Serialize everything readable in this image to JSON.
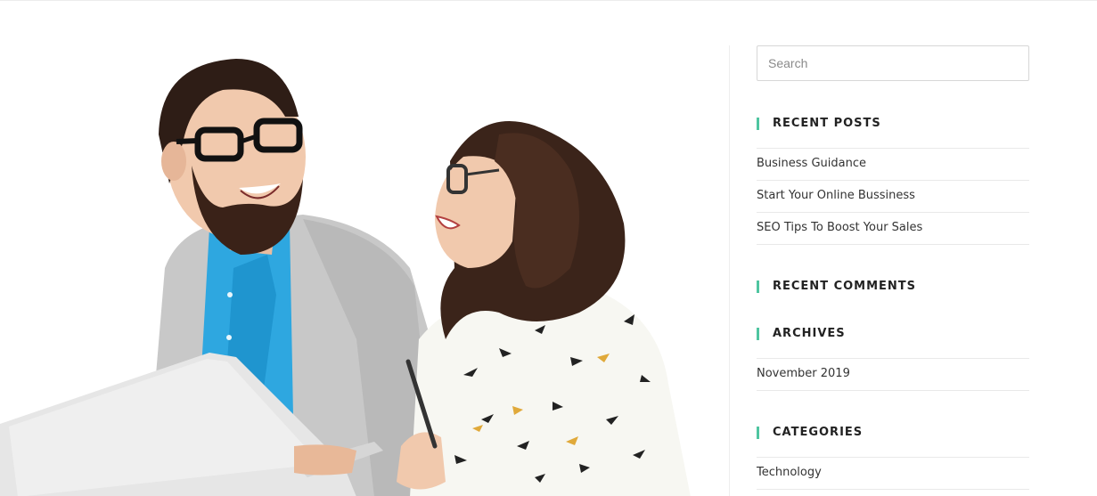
{
  "featured_image": {
    "description_icon": "photo-people-laptop",
    "colors": {
      "background": "#ffffff",
      "skin": "#f1c9ad",
      "hair": "#3a2218",
      "shirt": "#2ea7e0",
      "blazer": "#c9c9c9",
      "laptop": "#e2e2e2",
      "blouse": "#f7f7f2"
    }
  },
  "search": {
    "placeholder": "Search",
    "value": ""
  },
  "widgets": {
    "recent_posts": {
      "title": "RECENT POSTS",
      "items": [
        "Business Guidance",
        "Start Your Online Bussiness",
        "SEO Tips To Boost Your Sales"
      ]
    },
    "recent_comments": {
      "title": "RECENT COMMENTS"
    },
    "archives": {
      "title": "ARCHIVES",
      "items": [
        "November 2019"
      ]
    },
    "categories": {
      "title": "CATEGORIES",
      "items": [
        "Technology"
      ]
    }
  },
  "colors": {
    "accent": "#4fc5a0",
    "text": "#333333",
    "heading": "#222222",
    "divider": "#e9e9e9"
  }
}
